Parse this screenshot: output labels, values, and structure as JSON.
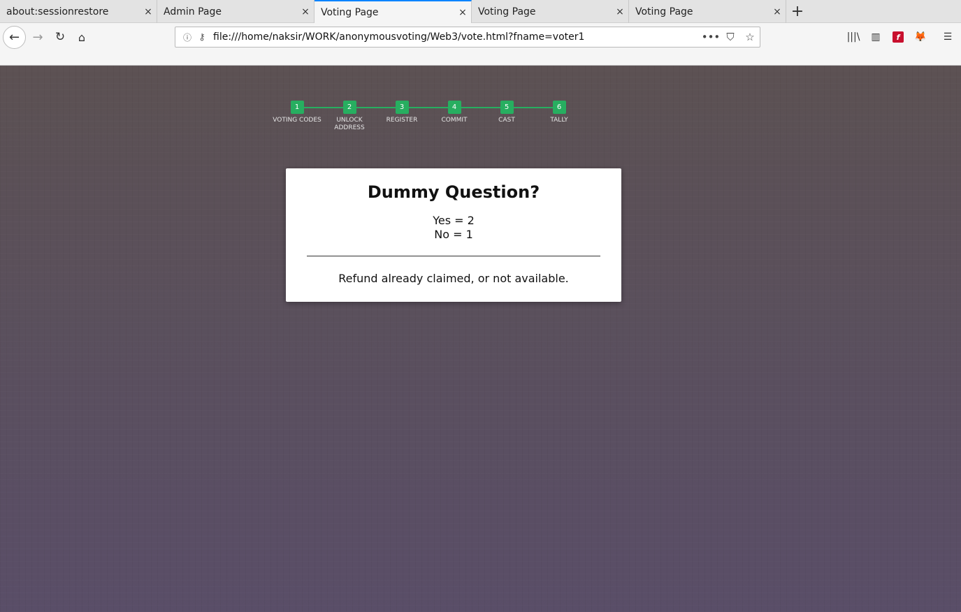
{
  "tabs": [
    {
      "title": "about:sessionrestore",
      "active": false
    },
    {
      "title": "Admin Page",
      "active": false
    },
    {
      "title": "Voting Page",
      "active": true
    },
    {
      "title": "Voting Page",
      "active": false
    },
    {
      "title": "Voting Page",
      "active": false
    }
  ],
  "icons": {
    "tab_close": "×",
    "new_tab": "+",
    "back": "←",
    "forward": "→",
    "reload": "↻",
    "home": "⌂",
    "info": "ⓘ",
    "key": "⚷",
    "more": "•••",
    "pocket": "⛉",
    "bookmark": "☆",
    "library": "|||\\",
    "sidebar": "▥",
    "flash": "f",
    "metamask": "🦊",
    "menu": "☰"
  },
  "urlbar": {
    "url": "file:///home/naksir/WORK/anonymousvoting/Web3/vote.html?fname=voter1"
  },
  "stepper": {
    "color": "#27ae60",
    "steps": [
      {
        "number": "1",
        "label": "VOTING CODES"
      },
      {
        "number": "2",
        "label": "UNLOCK ADDRESS"
      },
      {
        "number": "3",
        "label": "REGISTER"
      },
      {
        "number": "4",
        "label": "COMMIT"
      },
      {
        "number": "5",
        "label": "CAST"
      },
      {
        "number": "6",
        "label": "TALLY"
      }
    ]
  },
  "card": {
    "question": "Dummy Question?",
    "results": [
      "Yes = 2",
      "No = 1"
    ],
    "message": "Refund already claimed, or not available."
  }
}
